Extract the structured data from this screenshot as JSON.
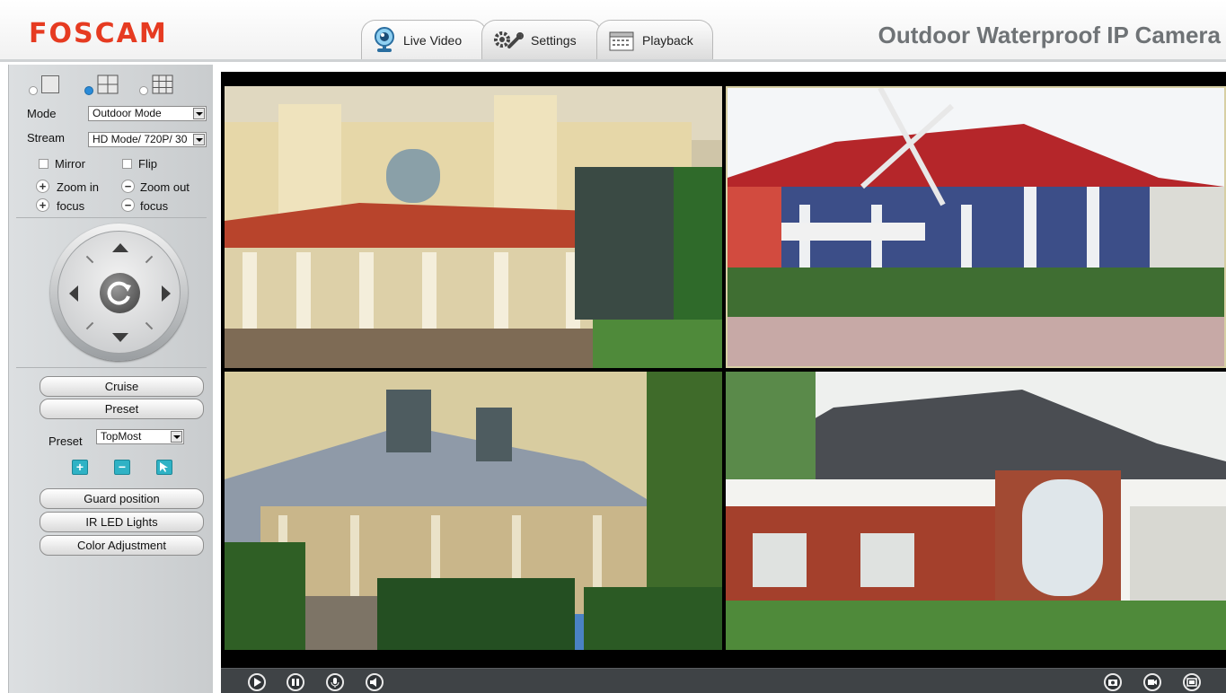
{
  "header": {
    "logo": "FOSCAM",
    "title": "Outdoor Waterproof IP Camera",
    "tabs": [
      {
        "label": "Live Video",
        "icon": "webcam-icon",
        "active": true
      },
      {
        "label": "Settings",
        "icon": "gears-icon",
        "active": false
      },
      {
        "label": "Playback",
        "icon": "calendar-icon",
        "active": false
      }
    ]
  },
  "sidebar": {
    "layout_options": [
      "single-view",
      "four-view",
      "nine-view"
    ],
    "layout_selected": "four-view",
    "mode_label": "Mode",
    "mode_value": "Outdoor Mode",
    "stream_label": "Stream",
    "stream_value": "HD Mode/ 720P/ 30",
    "mirror_label": "Mirror",
    "flip_label": "Flip",
    "zoom_in_label": "Zoom in",
    "zoom_out_label": "Zoom out",
    "focus_plus_label": "focus",
    "focus_minus_label": "focus",
    "cruise_label": "Cruise",
    "preset_button_label": "Preset",
    "preset_label": "Preset",
    "preset_value": "TopMost",
    "guard_label": "Guard position",
    "ir_label": "IR LED Lights",
    "color_label": "Color Adjustment"
  },
  "colors": {
    "brand": "#e63b21",
    "accent_select": "#2a8bd8",
    "teal_button": "#2fb2c5"
  }
}
